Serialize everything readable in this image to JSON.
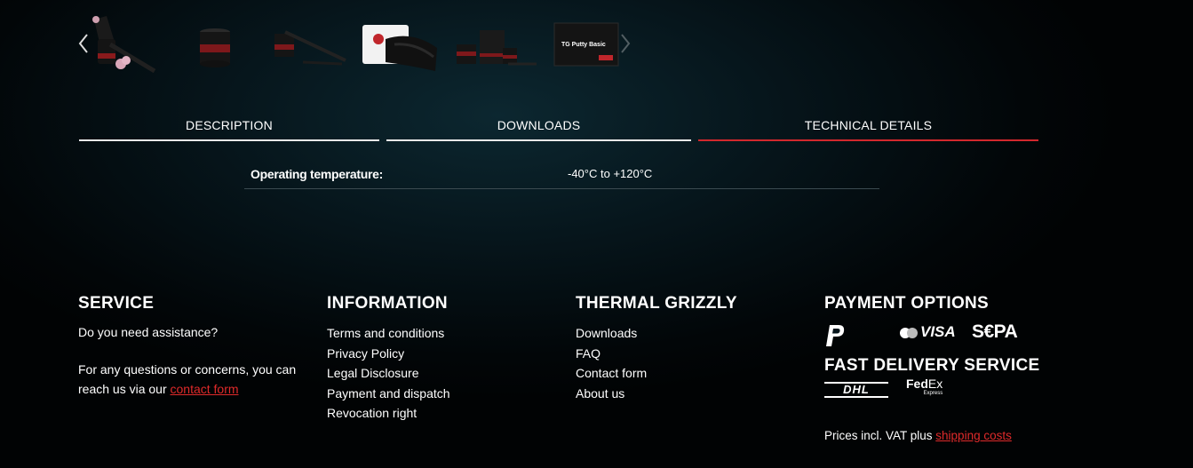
{
  "gallery": {
    "prev_icon": "chevron-left-icon",
    "next_icon": "chevron-right-icon",
    "thumbnails": [
      {
        "name": "product-thumb-applicator"
      },
      {
        "name": "product-thumb-tub"
      },
      {
        "name": "product-thumb-spatula"
      },
      {
        "name": "product-thumb-gloves"
      },
      {
        "name": "product-thumb-kit"
      },
      {
        "name": "product-thumb-box",
        "label": "TG Putty Basic"
      }
    ]
  },
  "tabs": [
    {
      "label": "DESCRIPTION",
      "active": false
    },
    {
      "label": "DOWNLOADS",
      "active": false
    },
    {
      "label": "TECHNICAL DETAILS",
      "active": true
    }
  ],
  "specs": [
    {
      "label": "Operating temperature:",
      "value": "-40°C to +120°C"
    }
  ],
  "footer": {
    "service": {
      "title": "SERVICE",
      "line1": "Do you need assistance?",
      "line2": "For any questions or concerns, you can",
      "line3_prefix": "reach us via our ",
      "link": "contact form"
    },
    "information": {
      "title": "INFORMATION",
      "links": [
        "Terms and conditions",
        "Privacy Policy",
        "Legal Disclosure",
        "Payment and dispatch",
        "Revocation right"
      ]
    },
    "thermal_grizzly": {
      "title": "THERMAL GRIZZLY",
      "links": [
        "Downloads",
        "FAQ",
        "Contact form",
        "About us"
      ]
    },
    "payment": {
      "title": "PAYMENT OPTIONS",
      "methods": [
        "paypal-icon",
        "mastercard-icon",
        "visa-icon",
        "sepa-icon"
      ],
      "visa": "VISA",
      "sepa": "S€PA"
    },
    "delivery": {
      "title": "FAST DELIVERY SERVICE",
      "carriers": [
        "dhl-icon",
        "fedex-icon"
      ],
      "dhl": "DHL",
      "fedex_a": "Fed",
      "fedex_b": "Ex",
      "fedex_c": "Express"
    },
    "prices_prefix": "Prices incl. VAT plus ",
    "prices_link": "shipping costs"
  },
  "colors": {
    "accent": "#d2282d",
    "link": "#e02a2a"
  }
}
